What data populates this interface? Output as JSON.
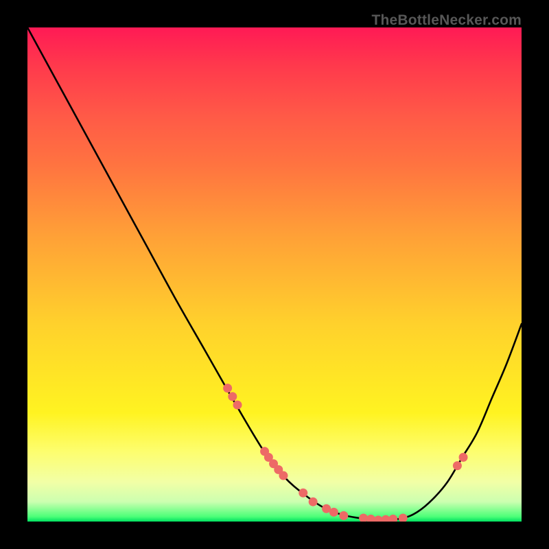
{
  "attribution": "TheBottleNecker.com",
  "colors": {
    "frame_background": "#000000",
    "attribution_text": "#575757",
    "curve_stroke": "#000000",
    "marker_fill": "#ed6a66"
  },
  "chart_data": {
    "type": "line",
    "title": "",
    "xlabel": "",
    "ylabel": "",
    "xlim": [
      0,
      100
    ],
    "ylim": [
      0,
      100
    ],
    "series": [
      {
        "name": "bottleneck-curve",
        "x": [
          0,
          6,
          12,
          18,
          24,
          30,
          36,
          42,
          48,
          52,
          56,
          60,
          64,
          68,
          72,
          76,
          79,
          82,
          85,
          88,
          91,
          94,
          97,
          100
        ],
        "y": [
          100,
          89,
          78,
          67,
          56,
          45,
          34.5,
          24,
          14,
          9,
          5.5,
          2.8,
          1.3,
          0.6,
          0.3,
          0.7,
          2,
          4.5,
          8,
          13,
          18,
          25,
          32,
          40
        ]
      }
    ],
    "markers": {
      "name": "highlighted-points",
      "x": [
        40.5,
        41.5,
        42.5,
        48.0,
        48.8,
        49.8,
        50.8,
        51.8,
        55.8,
        57.8,
        60.5,
        62.0,
        64.0,
        68.0,
        69.5,
        71.0,
        72.5,
        74.0,
        76.0,
        87.0,
        88.2
      ],
      "y": [
        27.0,
        25.3,
        23.6,
        14.2,
        13.0,
        11.7,
        10.5,
        9.3,
        5.8,
        4.0,
        2.6,
        1.9,
        1.2,
        0.7,
        0.5,
        0.3,
        0.4,
        0.5,
        0.7,
        11.3,
        13.0
      ]
    }
  }
}
